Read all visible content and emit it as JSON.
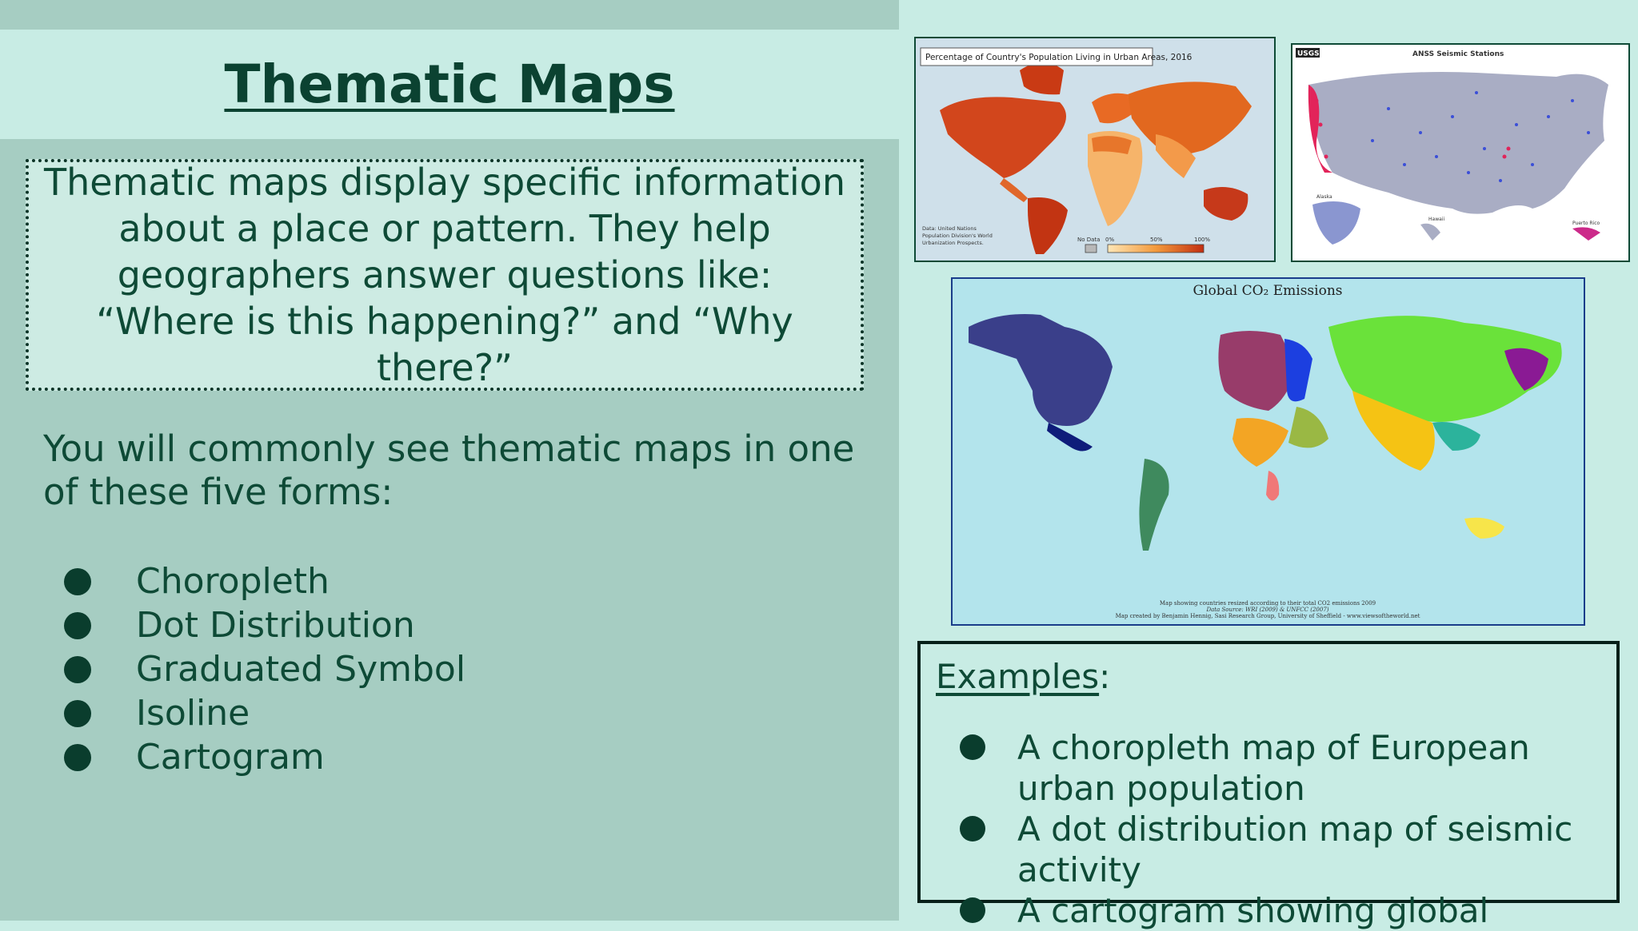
{
  "title": "Thematic Maps",
  "definition": "Thematic maps display specific information about a place or pattern. They help geographers answer questions like: “Where is this happening?” and “Why there?”",
  "intro": "You will commonly see thematic maps in one of these five forms:",
  "forms": [
    "Choropleth",
    "Dot Distribution",
    "Graduated Symbol",
    "Isoline",
    "Cartogram"
  ],
  "maps": {
    "urban": {
      "title": "Percentage of Country's Population Living in Urban Areas, 2016",
      "source": [
        "Data: United Nations",
        "Population Division's World",
        "Urbanization Prospects."
      ],
      "legend_no_data": "No Data",
      "legend_ticks": [
        "0%",
        "50%",
        "100%"
      ]
    },
    "seismic": {
      "logo": "USGS",
      "title": "ANSS Seismic Stations",
      "labels": [
        "Alaska",
        "Hawaii",
        "Puerto Rico"
      ]
    },
    "co2": {
      "title": "Global CO₂ Emissions",
      "credits": [
        "Map showing countries resized according to their total CO2 emissions 2009",
        "Data Source: WRI (2009) & UNFCC (2007)",
        "Map created by Benjamin Hennig, Sasi Research Group, University of Sheffield - www.viewsoftheworld.net"
      ]
    }
  },
  "examples": {
    "heading": "Examples",
    "items": [
      "A choropleth map of European urban population",
      "A dot distribution map of seismic activity",
      "A cartogram showing global"
    ]
  },
  "colors": {
    "accent_dark": "#0b4231",
    "panel": "#a6cdc2",
    "light": "#c8ece4"
  }
}
